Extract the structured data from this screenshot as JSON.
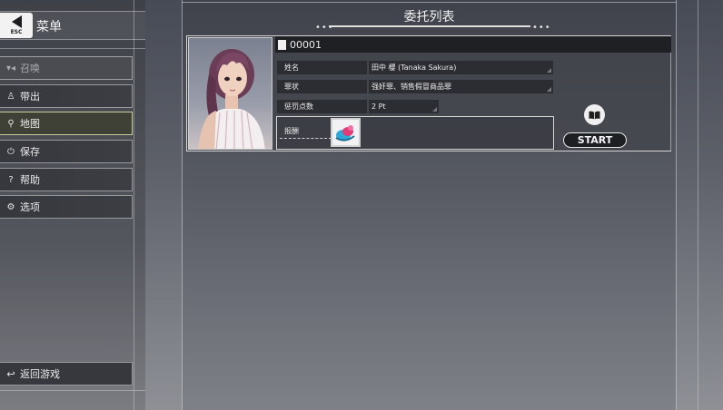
{
  "sidebar": {
    "esc_label": "ESC",
    "title": "菜单",
    "items": [
      {
        "label": "召唤",
        "icon": "summon-icon",
        "state": "disabled"
      },
      {
        "label": "带出",
        "icon": "person-out-icon",
        "state": "normal"
      },
      {
        "label": "地图",
        "icon": "map-pin-icon",
        "state": "active"
      },
      {
        "label": "保存",
        "icon": "save-icon",
        "state": "normal"
      },
      {
        "label": "帮助",
        "icon": "help-icon",
        "state": "normal"
      },
      {
        "label": "选项",
        "icon": "gear-icon",
        "state": "normal"
      }
    ],
    "back_label": "返回游戏"
  },
  "main": {
    "title": "委托列表",
    "request": {
      "id": "00001",
      "fields": [
        {
          "label": "姓名",
          "value": "田中 櫻 (Tanaka Sakura)"
        },
        {
          "label": "罪状",
          "value": "强奸罪、销售假冒商品罪"
        },
        {
          "label": "惩罚点数",
          "value": "2 Pt"
        }
      ],
      "reward_label": "报酬",
      "start_label": "START"
    }
  },
  "colors": {
    "active_border": "#c9cf9a",
    "panel_dark": "#2c2d32",
    "id_bar": "#1f2024"
  }
}
